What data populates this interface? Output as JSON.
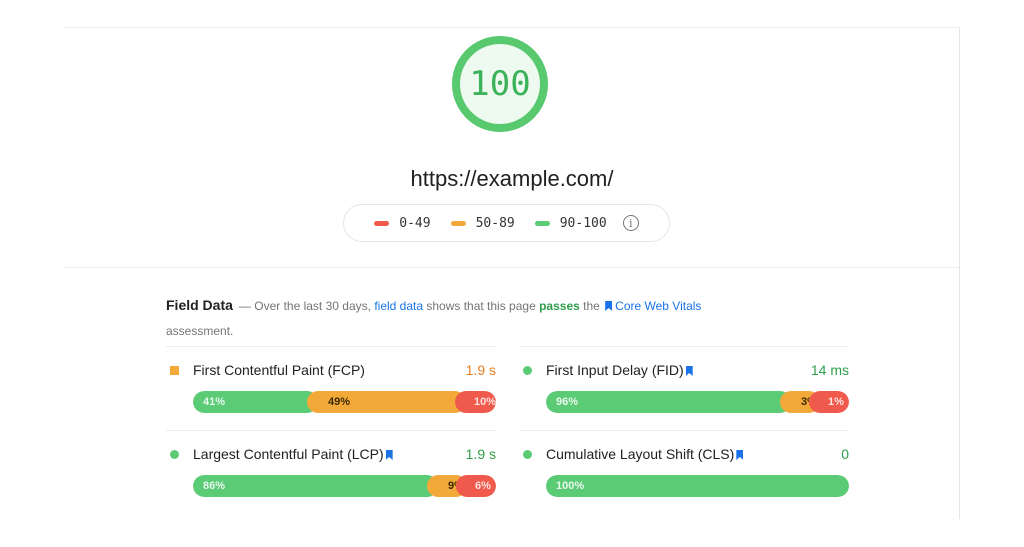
{
  "report": {
    "score": "100",
    "score_color": "#58c96f",
    "url": "https://example.com/",
    "legend": [
      {
        "label": "0-49",
        "color": "#ef5a4c"
      },
      {
        "label": "50-89",
        "color": "#f3a93a"
      },
      {
        "label": "90-100",
        "color": "#5ccb76"
      }
    ],
    "info_icon": "info-icon"
  },
  "field_data": {
    "title": "Field Data",
    "intro_prefix": "— Over the last 30 days, ",
    "link_text": "field data",
    "intro_mid": " shows that this page ",
    "status_word": "passes",
    "intro_after": " the ",
    "cwv_link": "Core Web Vitals",
    "intro_suffix": "assessment.",
    "metrics": [
      {
        "name": "First Contentful Paint (FCP)",
        "value": "1.9 s",
        "value_color": "#e67e22",
        "marker": "square",
        "marker_color": "#f3a93a",
        "cwv": false,
        "distribution": [
          {
            "label": "41%",
            "pct": 41
          },
          {
            "label": "49%",
            "pct": 49
          },
          {
            "label": "10%",
            "pct": 10
          }
        ]
      },
      {
        "name": "First Input Delay (FID)",
        "value": "14 ms",
        "value_color": "#2e9e4a",
        "marker": "circle",
        "marker_color": "#5ccb76",
        "cwv": true,
        "distribution": [
          {
            "label": "96%",
            "pct": 96
          },
          {
            "label": "3%",
            "pct": 3
          },
          {
            "label": "1%",
            "pct": 1
          }
        ]
      },
      {
        "name": "Largest Contentful Paint (LCP)",
        "value": "1.9 s",
        "value_color": "#2e9e4a",
        "marker": "circle",
        "marker_color": "#5ccb76",
        "cwv": true,
        "distribution": [
          {
            "label": "86%",
            "pct": 86
          },
          {
            "label": "9%",
            "pct": 9
          },
          {
            "label": "6%",
            "pct": 6
          }
        ]
      },
      {
        "name": "Cumulative Layout Shift (CLS)",
        "value": "0",
        "value_color": "#2e9e4a",
        "marker": "circle",
        "marker_color": "#5ccb76",
        "cwv": true,
        "distribution": [
          {
            "label": "100%",
            "pct": 100
          },
          {
            "label": "",
            "pct": 0
          },
          {
            "label": "",
            "pct": 0
          }
        ]
      }
    ]
  }
}
